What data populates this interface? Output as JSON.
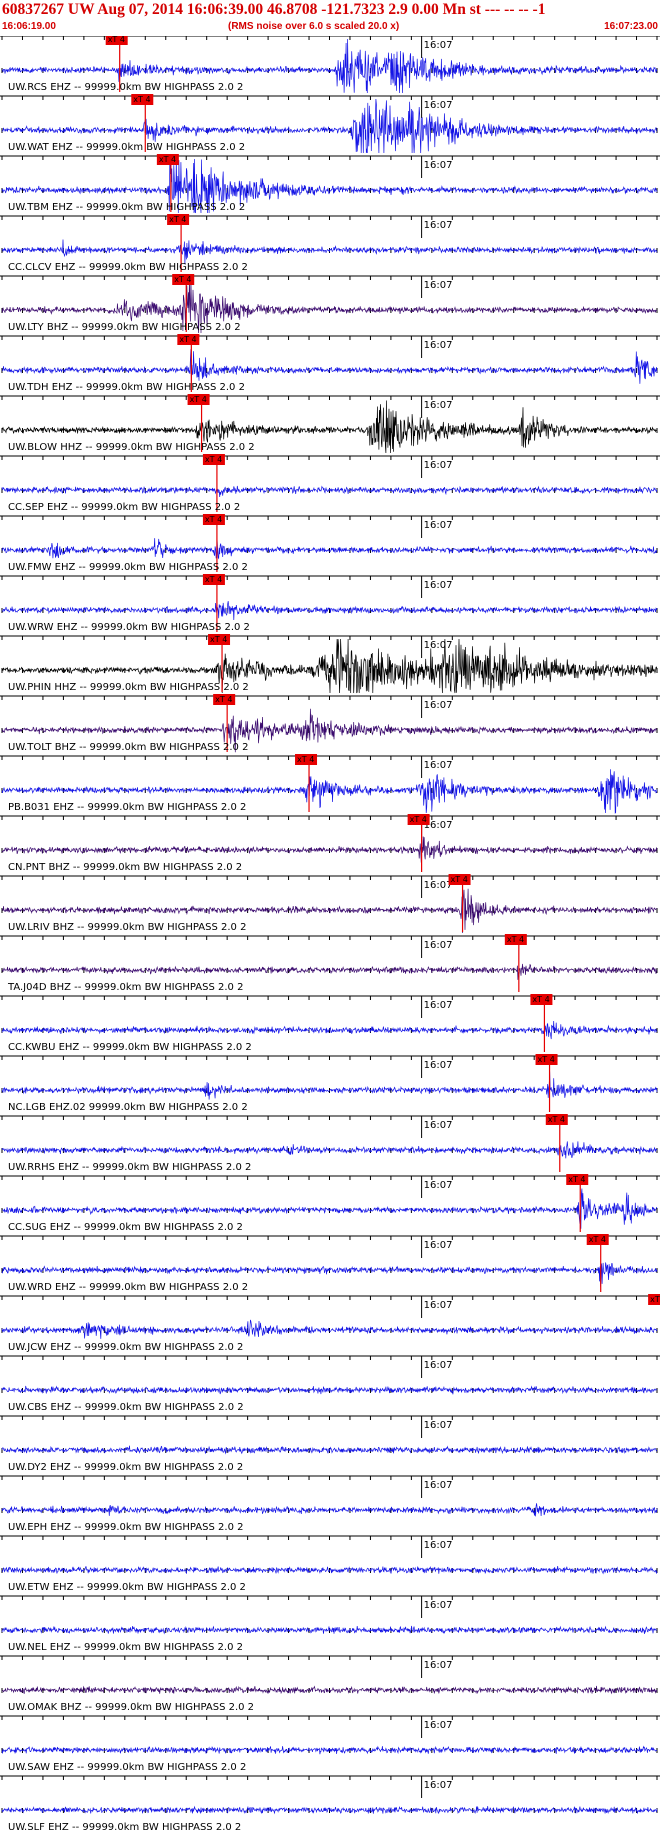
{
  "header": {
    "title": "60837267 UW Aug 07, 2014 16:06:39.00   46.8708 -121.7323  2.9 0.00 Mn st --- -- --   -1",
    "start_time": "16:06:19.00",
    "scale_note": "(RMS noise over 6.0 s scaled 20.0 x)",
    "end_time": "16:07:23.00"
  },
  "chart_data": {
    "type": "line",
    "title": "60837267 UW Aug 07, 2014 16:06:39.00   46.8708 -121.7323  2.9 0.00 Mn st --- -- --   -1",
    "x_range": [
      "16:06:19.00",
      "16:07:23.00"
    ],
    "minute_tick_label": "16:07",
    "pick_label": "xT 4",
    "colors": {
      "blue": "#1414e6",
      "black": "#000000",
      "purple": "#3a0a6e",
      "pick": "#e60000",
      "header": "#d40000"
    },
    "series": [
      {
        "name": "UW.RCS EHZ -- 99999.0km BW  HIGHPASS  2.0  2",
        "color": "blue",
        "pick_s": 11.5,
        "bursts": [
          [
            11.5,
            0.3,
            2.5,
            0.8
          ],
          [
            33.5,
            1.0,
            5.0,
            2.6
          ],
          [
            38.0,
            0.6,
            3.0,
            1.4
          ]
        ]
      },
      {
        "name": "UW.WAT EHZ -- 99999.0km BW  HIGHPASS  2.0  2",
        "color": "blue",
        "pick_s": 14.0,
        "bursts": [
          [
            14.0,
            0.3,
            2.5,
            0.8
          ],
          [
            35.0,
            1.0,
            5.0,
            2.6
          ],
          [
            40.0,
            0.6,
            3.0,
            1.2
          ]
        ]
      },
      {
        "name": "UW.TBM EHZ -- 99999.0km BW  HIGHPASS  2.0  2",
        "color": "blue",
        "pick_s": 16.5,
        "bursts": [
          [
            16.5,
            0.3,
            1.0,
            3.2
          ],
          [
            19.0,
            3.0,
            5.0,
            2.0
          ]
        ]
      },
      {
        "name": "CC.CLCV EHZ -- 99999.0km BW  HIGHPASS  2.0  2",
        "color": "blue",
        "pick_s": 17.5,
        "bursts": [
          [
            6.0,
            0.3,
            0.5,
            0.6
          ],
          [
            17.5,
            0.4,
            2.5,
            0.8
          ]
        ]
      },
      {
        "name": "UW.LTY BHZ -- 99999.0km BW  HIGHPASS  2.0  2",
        "color": "purple",
        "pick_s": 18.0,
        "bursts": [
          [
            18.0,
            0.8,
            3.0,
            2.8
          ],
          [
            12.0,
            1.0,
            3.0,
            1.0
          ]
        ]
      },
      {
        "name": "UW.TDH EHZ -- 99999.0km BW  HIGHPASS  2.0  2",
        "color": "blue",
        "pick_s": 18.5,
        "bursts": [
          [
            18.5,
            0.6,
            2.0,
            1.2
          ],
          [
            62.0,
            0.5,
            1.5,
            1.4
          ]
        ]
      },
      {
        "name": "UW.BLOW HHZ -- 99999.0km BW  HIGHPASS  2.0  2",
        "color": "black",
        "pick_s": 19.5,
        "bursts": [
          [
            19.5,
            0.8,
            3.0,
            1.0
          ],
          [
            37.0,
            1.5,
            4.0,
            2.6
          ],
          [
            51.0,
            0.5,
            1.5,
            1.6
          ]
        ]
      },
      {
        "name": "CC.SEP EHZ -- 99999.0km BW  HIGHPASS  2.0  2",
        "color": "blue",
        "pick_s": 21.0,
        "bursts": [
          [
            21.0,
            0.3,
            1.0,
            0.4
          ]
        ]
      },
      {
        "name": "UW.FMW EHZ -- 99999.0km BW  HIGHPASS  2.0  2",
        "color": "blue",
        "pick_s": 21.0,
        "bursts": [
          [
            5.0,
            0.5,
            1.0,
            0.6
          ],
          [
            15.0,
            0.5,
            1.0,
            0.7
          ],
          [
            21.0,
            0.3,
            1.0,
            0.8
          ]
        ]
      },
      {
        "name": "UW.WRW EHZ -- 99999.0km BW  HIGHPASS  2.0  2",
        "color": "blue",
        "pick_s": 21.0,
        "bursts": [
          [
            21.0,
            0.3,
            2.0,
            0.8
          ]
        ]
      },
      {
        "name": "UW.PHIN HHZ -- 99999.0km BW  HIGHPASS  2.0  2",
        "color": "black",
        "pick_s": 21.5,
        "bursts": [
          [
            21.5,
            1.0,
            4.0,
            1.2
          ],
          [
            33.0,
            3.0,
            7.0,
            3.0
          ],
          [
            44.0,
            3.0,
            8.0,
            1.8
          ]
        ]
      },
      {
        "name": "UW.TOLT BHZ -- 99999.0km BW  HIGHPASS  2.0  2",
        "color": "purple",
        "pick_s": 22.0,
        "bursts": [
          [
            22.0,
            0.6,
            4.0,
            1.4
          ],
          [
            30.0,
            1.0,
            4.0,
            0.8
          ]
        ]
      },
      {
        "name": "PB.B031 EHZ -- 99999.0km BW  HIGHPASS  2.0  2",
        "color": "blue",
        "pick_s": 30.0,
        "bursts": [
          [
            30.0,
            0.6,
            2.0,
            1.6
          ],
          [
            41.0,
            0.6,
            2.5,
            2.0
          ],
          [
            59.0,
            1.0,
            3.0,
            1.8
          ]
        ]
      },
      {
        "name": "CN.PNT BHZ -- 99999.0km BW  HIGHPASS  2.0  2",
        "color": "purple",
        "pick_s": 41.0,
        "bursts": [
          [
            41.0,
            0.3,
            1.2,
            1.4
          ]
        ]
      },
      {
        "name": "UW.LRIV BHZ -- 99999.0km BW  HIGHPASS  2.0  2",
        "color": "purple",
        "pick_s": 45.0,
        "bursts": [
          [
            45.0,
            0.4,
            1.5,
            2.0
          ]
        ]
      },
      {
        "name": "TA.J04D BHZ -- 99999.0km BW  HIGHPASS  2.0  2",
        "color": "purple",
        "pick_s": 50.5,
        "bursts": [
          [
            50.5,
            0.2,
            0.8,
            0.8
          ]
        ]
      },
      {
        "name": "CC.KWBU EHZ -- 99999.0km BW  HIGHPASS  2.0  2",
        "color": "blue",
        "pick_s": 53.0,
        "bursts": [
          [
            53.0,
            0.3,
            1.5,
            0.7
          ]
        ]
      },
      {
        "name": "NC.LGB EHZ.02 99999.0km BW  HIGHPASS  2.0  2",
        "color": "blue",
        "pick_s": 53.5,
        "bursts": [
          [
            20.0,
            0.5,
            1.0,
            0.8
          ],
          [
            53.5,
            0.4,
            1.5,
            0.9
          ]
        ]
      },
      {
        "name": "UW.RRHS EHZ -- 99999.0km BW  HIGHPASS  2.0  2",
        "color": "blue",
        "pick_s": 54.5,
        "bursts": [
          [
            54.5,
            0.4,
            2.0,
            0.8
          ],
          [
            28.0,
            0.3,
            0.6,
            0.5
          ]
        ]
      },
      {
        "name": "CC.SUG EHZ -- 99999.0km BW  HIGHPASS  2.0  2",
        "color": "blue",
        "pick_s": 56.5,
        "bursts": [
          [
            56.5,
            0.4,
            2.0,
            1.4
          ],
          [
            61.0,
            0.5,
            1.0,
            0.9
          ]
        ]
      },
      {
        "name": "UW.WRD EHZ -- 99999.0km BW  HIGHPASS  2.0  2",
        "color": "blue",
        "pick_s": 58.5,
        "bursts": [
          [
            58.5,
            0.3,
            1.0,
            1.0
          ]
        ]
      },
      {
        "name": "UW.JCW EHZ -- 99999.0km BW  HIGHPASS  2.0  2",
        "color": "blue",
        "pick_s": 64.5,
        "bursts": [
          [
            8.0,
            1.0,
            2.5,
            0.7
          ],
          [
            24.0,
            1.0,
            2.0,
            0.6
          ]
        ]
      },
      {
        "name": "UW.CBS EHZ -- 99999.0km BW  HIGHPASS  2.0  2",
        "color": "blue",
        "bursts": []
      },
      {
        "name": "UW.DY2 EHZ -- 99999.0km BW  HIGHPASS  2.0  2",
        "color": "blue",
        "bursts": []
      },
      {
        "name": "UW.EPH EHZ -- 99999.0km BW  HIGHPASS  2.0  2",
        "color": "blue",
        "bursts": [
          [
            10.5,
            0.2,
            0.5,
            0.8
          ],
          [
            52.0,
            0.2,
            0.5,
            0.9
          ]
        ]
      },
      {
        "name": "UW.ETW EHZ -- 99999.0km BW  HIGHPASS  2.0  2",
        "color": "blue",
        "bursts": []
      },
      {
        "name": "UW.NEL EHZ -- 99999.0km BW  HIGHPASS  2.0  2",
        "color": "blue",
        "bursts": []
      },
      {
        "name": "UW.OMAK BHZ -- 99999.0km BW  HIGHPASS  2.0  2",
        "color": "purple",
        "bursts": []
      },
      {
        "name": "UW.SAW EHZ -- 99999.0km BW  HIGHPASS  2.0  2",
        "color": "blue",
        "bursts": []
      },
      {
        "name": "UW.SLF EHZ -- 99999.0km BW  HIGHPASS  2.0  2",
        "color": "blue",
        "bursts": []
      }
    ]
  }
}
